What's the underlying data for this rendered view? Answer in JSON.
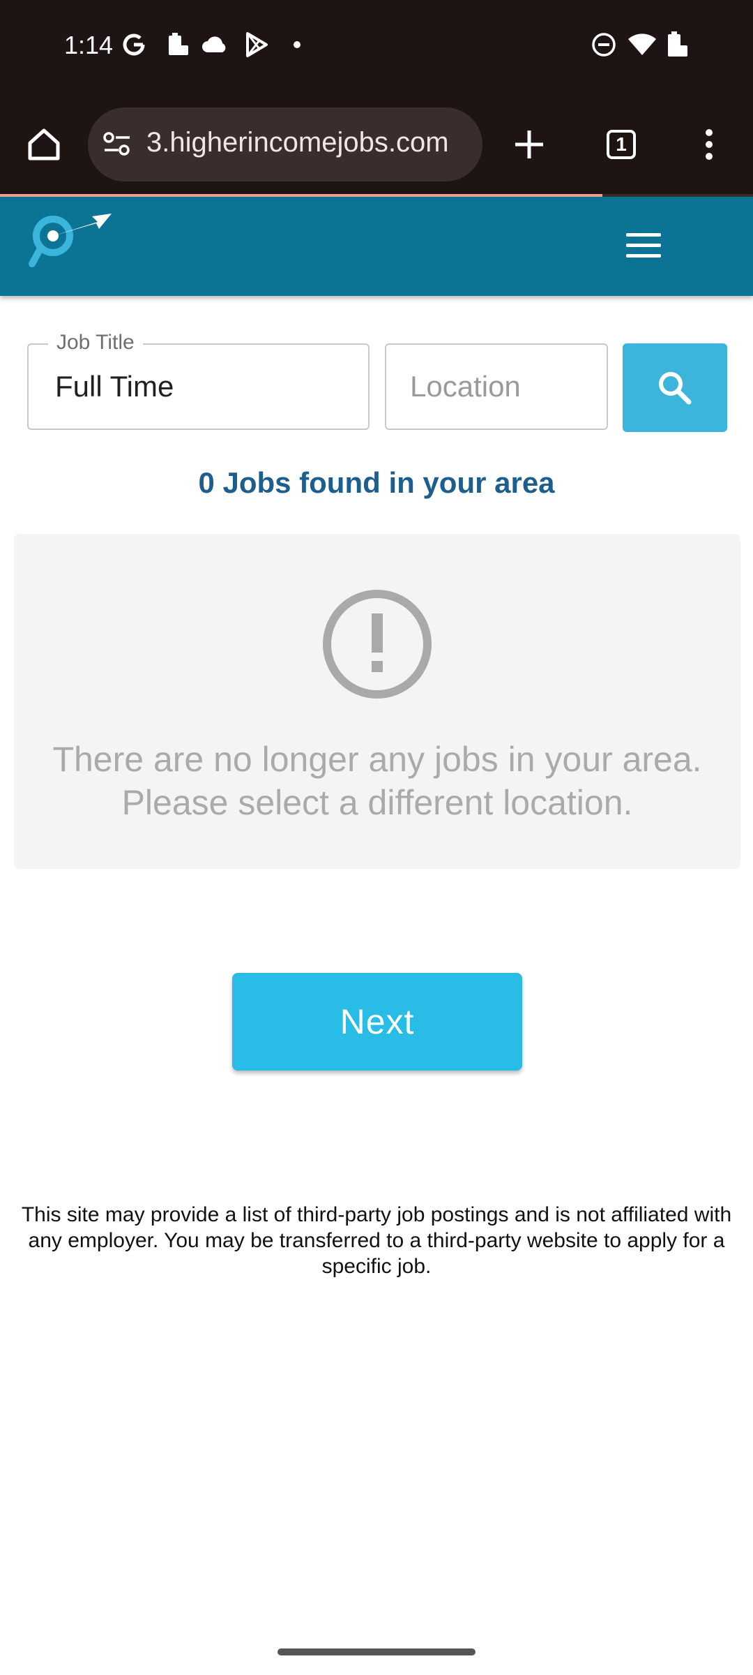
{
  "status_bar": {
    "time": "1:14",
    "left_icons": [
      "google-icon",
      "battery-saver-icon",
      "cloud-icon",
      "play-store-icon",
      "dot-icon"
    ],
    "right_icons": [
      "dnd-icon",
      "wifi-icon",
      "battery-icon"
    ]
  },
  "browser": {
    "url": "3.higherincomejobs.com",
    "tab_count": "1",
    "load_progress": 0.8
  },
  "search": {
    "job_title_label": "Job Title",
    "job_title_value": "Full Time",
    "location_placeholder": "Location"
  },
  "results": {
    "count_text": "0 Jobs found in your area",
    "empty_message": "There are no longer any jobs in your area. Please select a different location."
  },
  "next_button_label": "Next",
  "disclaimer": "This site may provide a list of third-party job postings and is not affiliated with any employer. You may be transferred to a third-party website to apply for a specific job.",
  "colors": {
    "header": "#0b7495",
    "search_button": "#3cb5dc",
    "next_button": "#29bce6",
    "results_text": "#1c5f8e"
  }
}
